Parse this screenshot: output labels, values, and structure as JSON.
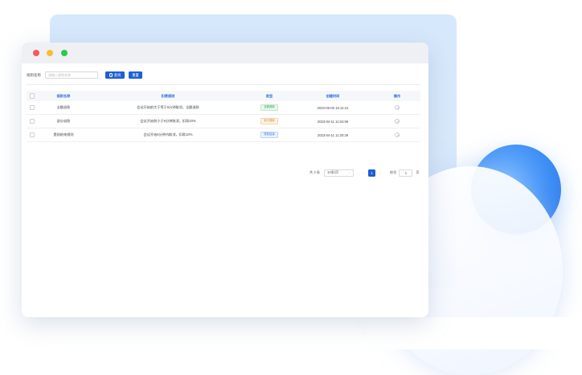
{
  "search": {
    "label": "规则名称",
    "placeholder": "请输入规则名称",
    "query_button": "查询",
    "reset_button": "重置"
  },
  "table": {
    "headers": {
      "name": "规则名称",
      "rule": "扣费规则",
      "type": "类型",
      "created": "创建时间",
      "action": "操作"
    },
    "rows": [
      {
        "name": "全额退款",
        "rule": "会议开始前大于等于5分钟取消，全额退款",
        "type": "全额退款",
        "created": "2023-05-05 15:14:41"
      },
      {
        "name": "部分退款",
        "rule": "会议开始前小于5分钟取消，扣款20%",
        "type": "部分退款",
        "created": "2023-04-11 11:04:59"
      },
      {
        "name": "提前结束规则",
        "rule": "会议开始5分钟内取消，扣款10%",
        "type": "提前结束",
        "created": "2023-04-11 11:20:29"
      }
    ]
  },
  "pagination": {
    "total": "共 3 条",
    "page_size": "10条/页",
    "current_page": "1",
    "goto_label": "前往",
    "goto_value": "1",
    "page_unit": "页"
  },
  "colors": {
    "primary": "#1d5fd6",
    "tag_green": "#3aa657",
    "tag_orange": "#e48c2c",
    "tag_blue": "#3f79e0"
  }
}
